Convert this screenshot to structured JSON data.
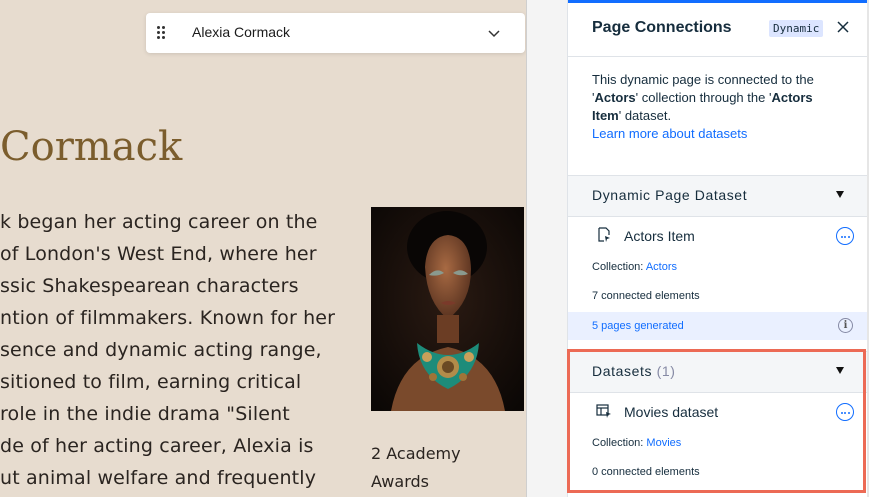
{
  "canvas": {
    "item_picker": {
      "value": "Alexia Cormack"
    },
    "heading": "Cormack",
    "bio_lines": [
      "k began her acting career on the",
      "of London's West End, where her",
      "ssic Shakespearean characters",
      "ntion of filmmakers. Known for her",
      "sence and dynamic acting range,",
      "sitioned to film, earning critical",
      "role in the indie drama \"Silent",
      "de of her acting career, Alexia is",
      "ut animal welfare and frequently"
    ],
    "awards_lines": [
      "2 Academy",
      "Awards"
    ]
  },
  "panel": {
    "title": "Page Connections",
    "badge": "Dynamic",
    "info": {
      "text_1": "This dynamic page is connected to the",
      "text_2a": "'",
      "collection": "Actors",
      "text_2b": "' collection through the '",
      "dataset_1": "Actors",
      "dataset_2": "Item",
      "text_3": "' dataset.",
      "link": "Learn more about datasets"
    },
    "dynamic_section": {
      "title": "Dynamic Page Dataset",
      "dataset_name": "Actors Item",
      "collection_label": "Collection:",
      "collection_value": "Actors",
      "connected": "7 connected elements",
      "pages_generated": "5 pages generated"
    },
    "datasets_section": {
      "title": "Datasets",
      "count": "(1)",
      "dataset_name": "Movies dataset",
      "collection_label": "Collection:",
      "collection_value": "Movies",
      "connected": "0 connected elements"
    }
  },
  "colors": {
    "canvas_bg": "#e7dccf",
    "heading": "#7b5d2d",
    "accent": "#116dff",
    "highlight": "#ec6a55"
  },
  "icons": [
    "drag-handle-icon",
    "chevron-down-icon",
    "close-icon",
    "dynamic-dataset-icon",
    "more-icon",
    "info-icon",
    "collapse-triangle-icon",
    "dataset-icon"
  ]
}
